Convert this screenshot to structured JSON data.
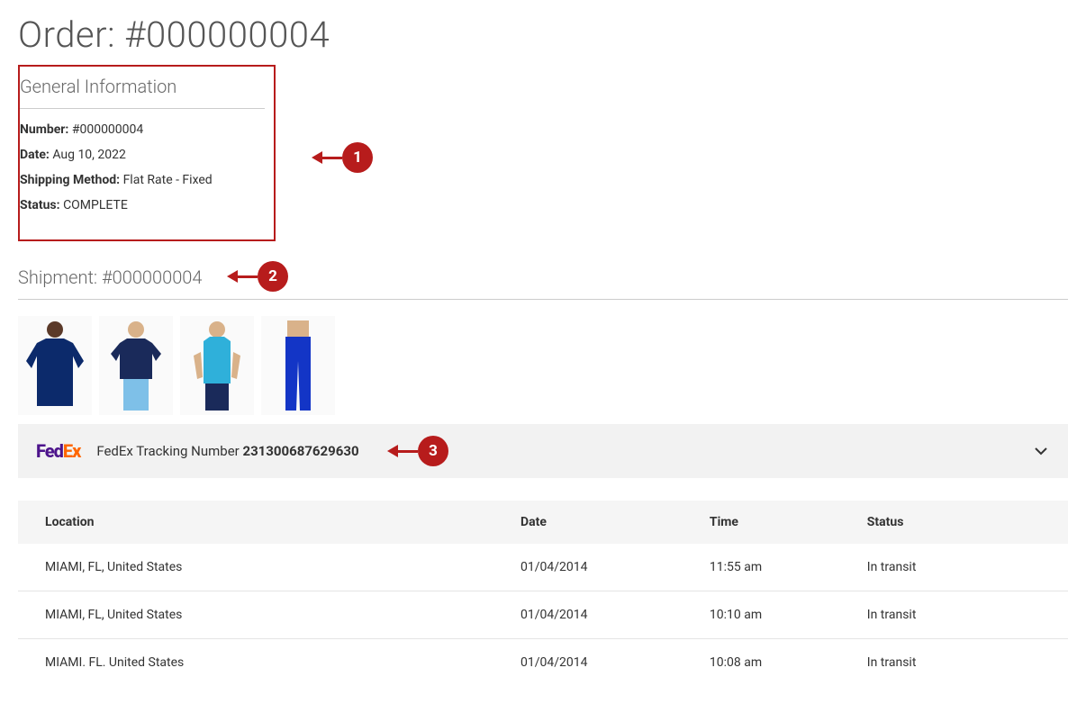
{
  "page_title": "Order: #000000004",
  "general_info": {
    "heading": "General Information",
    "fields": {
      "number_label": "Number:",
      "number_value": "#000000004",
      "date_label": "Date:",
      "date_value": "Aug 10, 2022",
      "shipping_label": "Shipping Method:",
      "shipping_value": "Flat Rate - Fixed",
      "status_label": "Status:",
      "status_value": "COMPLETE"
    }
  },
  "callouts": {
    "one": "1",
    "two": "2",
    "three": "3"
  },
  "shipment": {
    "heading": "Shipment: #000000004"
  },
  "tracking": {
    "carrier_fed": "Fed",
    "carrier_ex": "Ex",
    "label": "FedEx Tracking Number ",
    "number": "231300687629630"
  },
  "table": {
    "headers": {
      "location": "Location",
      "date": "Date",
      "time": "Time",
      "status": "Status"
    },
    "rows": [
      {
        "location": "MIAMI, FL, United States",
        "date": "01/04/2014",
        "time": "11:55 am",
        "status": "In transit"
      },
      {
        "location": "MIAMI, FL, United States",
        "date": "01/04/2014",
        "time": "10:10 am",
        "status": "In transit"
      },
      {
        "location": "MIAMI. FL. United States",
        "date": "01/04/2014",
        "time": "10:08 am",
        "status": "In transit"
      }
    ]
  }
}
